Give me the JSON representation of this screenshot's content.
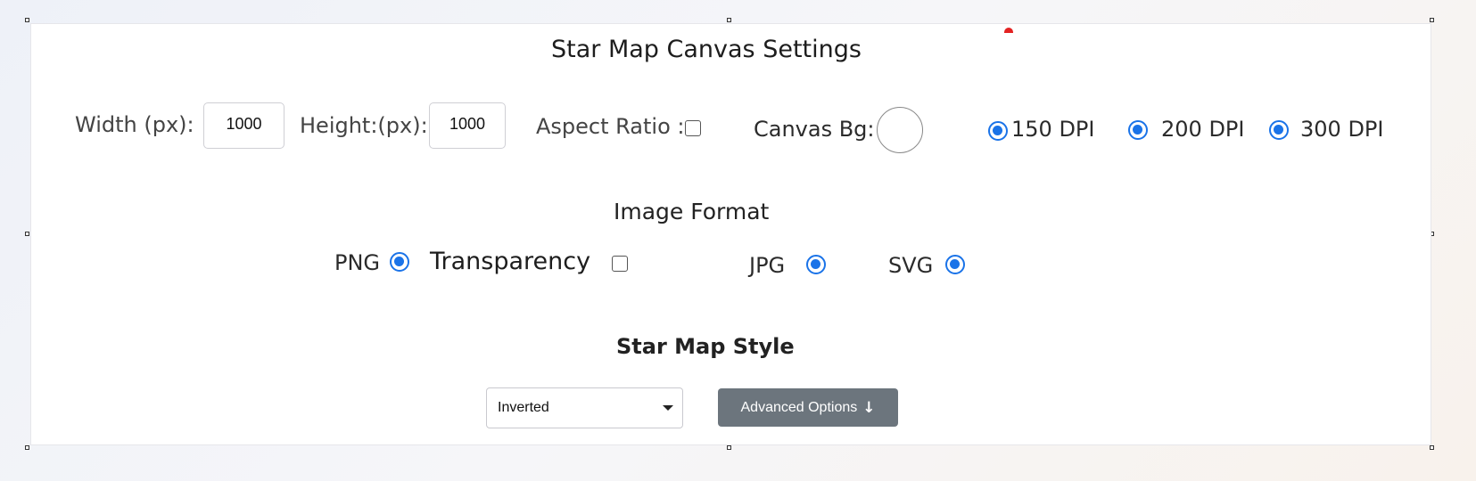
{
  "header": {
    "title": "Star Map Canvas Settings"
  },
  "canvas": {
    "width_label": "Width (px):",
    "width_value": "1000",
    "height_label": "Height:(px):",
    "height_value": "1000",
    "aspect_ratio_label": "Aspect Ratio :",
    "aspect_ratio_checked": false,
    "bg_label": "Canvas Bg:",
    "bg_color": "#ffffff"
  },
  "dpi": {
    "options": [
      {
        "label": "150 DPI",
        "checked": true
      },
      {
        "label": "200 DPI",
        "checked": true
      },
      {
        "label": "300 DPI",
        "checked": true
      }
    ]
  },
  "format": {
    "heading": "Image Format",
    "png_label": "PNG",
    "transparency_label": "Transparency",
    "transparency_checked": false,
    "jpg_label": "JPG",
    "svg_label": "SVG"
  },
  "style": {
    "heading": "Star Map Style",
    "selected": "Inverted",
    "advanced_button_label": "Advanced Options",
    "advanced_button_icon": "arrow-down-icon"
  },
  "colors": {
    "accent": "#1a73e8",
    "button_bg": "#6c757d",
    "handle_marker": "#e32222"
  }
}
